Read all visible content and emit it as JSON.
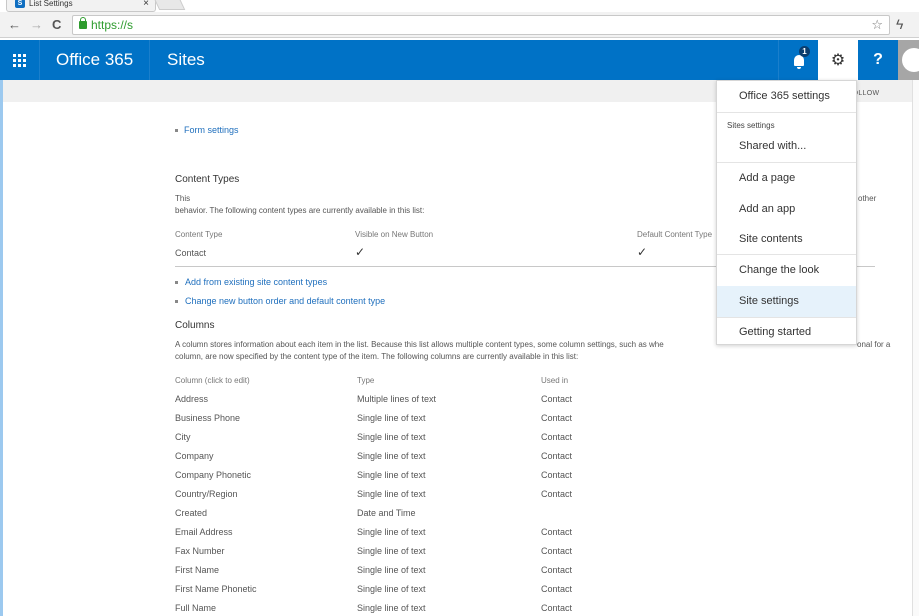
{
  "browser": {
    "tab_title": "List Settings",
    "tab_close": "×",
    "url": "https://s",
    "back_icon": "←",
    "forward_icon": "→",
    "reload_icon": "C",
    "star_icon": "☆",
    "extension_icon": "ϟ"
  },
  "suitebar": {
    "brand": "Office 365",
    "app": "Sites",
    "notification_count": "1",
    "gear_icon": "⚙",
    "help_label": "?",
    "accent": "#0072c6"
  },
  "ribbon": {
    "follow_label": "FOLLOW",
    "follow_icon": "☆"
  },
  "general_settings": {
    "form_settings": "Form settings"
  },
  "content_types": {
    "heading": "Content Types",
    "desc_line1": "This",
    "desc_line2": "behavior. The following content types are currently available in this list:",
    "desc_right": "other",
    "headers": [
      "Content Type",
      "Visible on New Button",
      "Default Content Type"
    ],
    "rows": [
      {
        "name": "Contact",
        "visible": "✓",
        "default": "✓"
      }
    ],
    "links": [
      "Add from existing site content types",
      "Change new button order and default content type"
    ]
  },
  "columns": {
    "heading": "Columns",
    "desc_line1": "A column stores information about each item in the list. Because this list allows multiple content types, some column settings, such as whe",
    "desc_line1_end": "onal for a",
    "desc_line2": "column, are now specified by the content type of the item. The following columns are currently available in this list:",
    "headers": [
      "Column (click to edit)",
      "Type",
      "Used in"
    ],
    "rows": [
      {
        "name": "Address",
        "type": "Multiple lines of text",
        "used": "Contact"
      },
      {
        "name": "Business Phone",
        "type": "Single line of text",
        "used": "Contact"
      },
      {
        "name": "City",
        "type": "Single line of text",
        "used": "Contact"
      },
      {
        "name": "Company",
        "type": "Single line of text",
        "used": "Contact"
      },
      {
        "name": "Company Phonetic",
        "type": "Single line of text",
        "used": "Contact"
      },
      {
        "name": "Country/Region",
        "type": "Single line of text",
        "used": "Contact"
      },
      {
        "name": "Created",
        "type": "Date and Time",
        "used": ""
      },
      {
        "name": "Email Address",
        "type": "Single line of text",
        "used": "Contact"
      },
      {
        "name": "Fax Number",
        "type": "Single line of text",
        "used": "Contact"
      },
      {
        "name": "First Name",
        "type": "Single line of text",
        "used": "Contact"
      },
      {
        "name": "First Name Phonetic",
        "type": "Single line of text",
        "used": "Contact"
      },
      {
        "name": "Full Name",
        "type": "Single line of text",
        "used": "Contact"
      }
    ]
  },
  "settings_menu": {
    "office365_settings": "Office 365 settings",
    "group_label": "Sites settings",
    "items": [
      "Shared with...",
      "Add a page",
      "Add an app",
      "Site contents",
      "Change the look",
      "Site settings",
      "Getting started"
    ],
    "active_item": "Site settings"
  }
}
